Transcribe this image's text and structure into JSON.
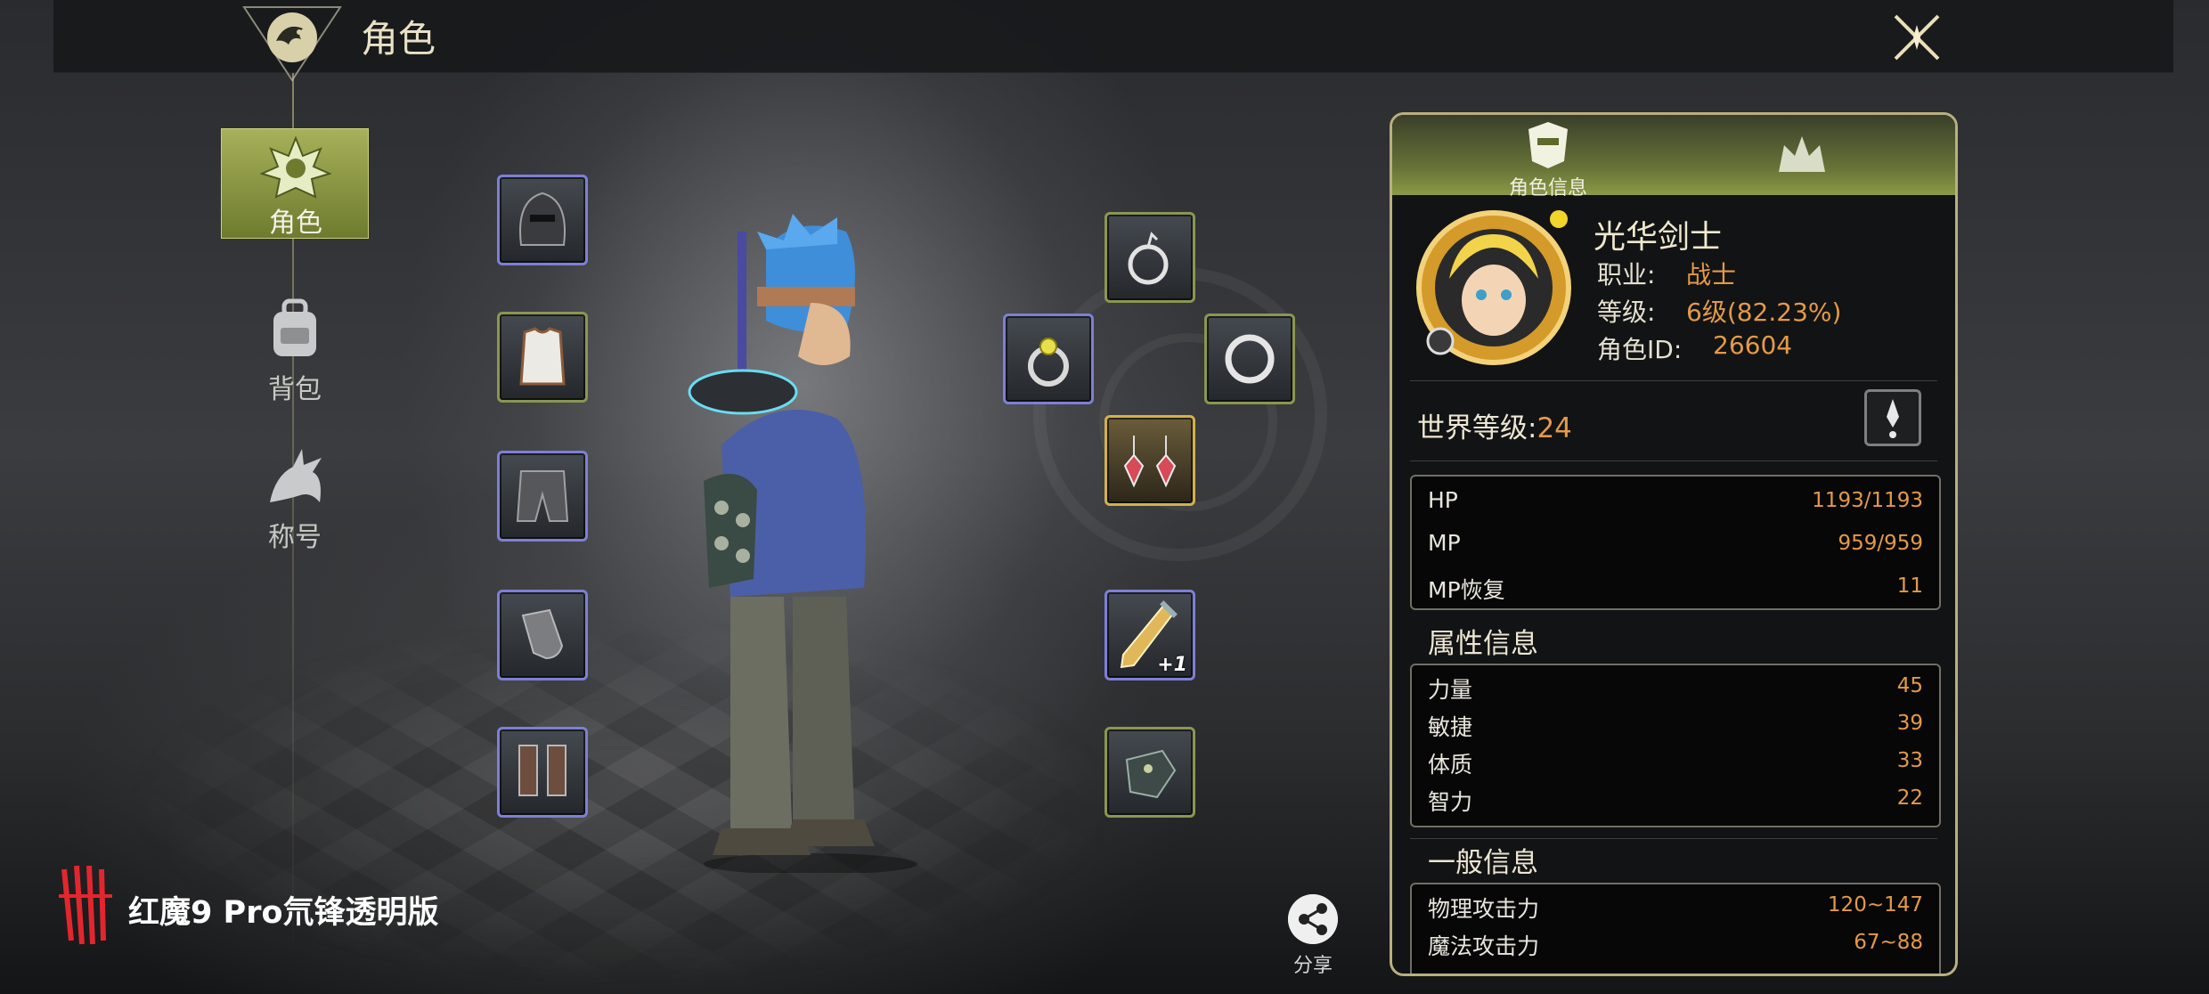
{
  "header": {
    "title": "角色"
  },
  "nav": {
    "items": [
      {
        "label": "角色",
        "icon": "character-crest-icon",
        "active": true
      },
      {
        "label": "背包",
        "icon": "backpack-icon",
        "active": false
      },
      {
        "label": "称号",
        "icon": "dragon-title-icon",
        "active": false
      }
    ]
  },
  "equipment": {
    "left": [
      {
        "slot": "helmet",
        "icon": "helmet-icon",
        "rarity": "blue"
      },
      {
        "slot": "armor",
        "icon": "vest-icon",
        "rarity": "green"
      },
      {
        "slot": "pants",
        "icon": "pants-icon",
        "rarity": "blue"
      },
      {
        "slot": "gloves",
        "icon": "gauntlet-icon",
        "rarity": "blue"
      },
      {
        "slot": "boots",
        "icon": "boots-icon",
        "rarity": "blue"
      }
    ],
    "right": [
      {
        "slot": "necklace",
        "icon": "necklace-icon",
        "rarity": "green"
      },
      {
        "slot": "ring-1",
        "icon": "gem-ring-icon",
        "rarity": "blue"
      },
      {
        "slot": "ring-2",
        "icon": "ring-icon",
        "rarity": "green"
      },
      {
        "slot": "earrings",
        "icon": "earring-icon",
        "rarity": "gold"
      },
      {
        "slot": "weapon",
        "icon": "sword-icon",
        "rarity": "blue",
        "enhance": "+1"
      },
      {
        "slot": "offhand",
        "icon": "fist-weapon-icon",
        "rarity": "green"
      }
    ]
  },
  "brand": {
    "text": "红魔9 Pro氘锋透明版"
  },
  "share": {
    "label": "分享"
  },
  "panel": {
    "tabs": [
      {
        "label": "角色信息",
        "icon": "helmet-crest-icon",
        "active": true
      },
      {
        "label": "",
        "icon": "crown-icon",
        "active": false
      }
    ],
    "character": {
      "name": "光华剑士",
      "class_label": "职业:",
      "class_value": "战士",
      "level_label": "等级:",
      "level_value": "6级(82.23%)",
      "id_label": "角色ID:",
      "id_value": "26604"
    },
    "world_level": {
      "label": "世界等级:",
      "value": "24"
    },
    "vitals": [
      {
        "label": "HP",
        "value": "1193/1193"
      },
      {
        "label": "MP",
        "value": "959/959"
      },
      {
        "label": "MP恢复",
        "value": "11"
      }
    ],
    "attributes": {
      "title": "属性信息",
      "items": [
        {
          "label": "力量",
          "value": "45"
        },
        {
          "label": "敏捷",
          "value": "39"
        },
        {
          "label": "体质",
          "value": "33"
        },
        {
          "label": "智力",
          "value": "22"
        }
      ]
    },
    "general": {
      "title": "一般信息",
      "items": [
        {
          "label": "物理攻击力",
          "value": "120~147"
        },
        {
          "label": "魔法攻击力",
          "value": "67~88"
        }
      ]
    }
  },
  "colors": {
    "accent": "#e39a48",
    "nav_active": "#8c9a3e",
    "slot_blue": "#7e7fd6",
    "slot_green": "#8a9650",
    "slot_gold": "#d3b04a"
  }
}
